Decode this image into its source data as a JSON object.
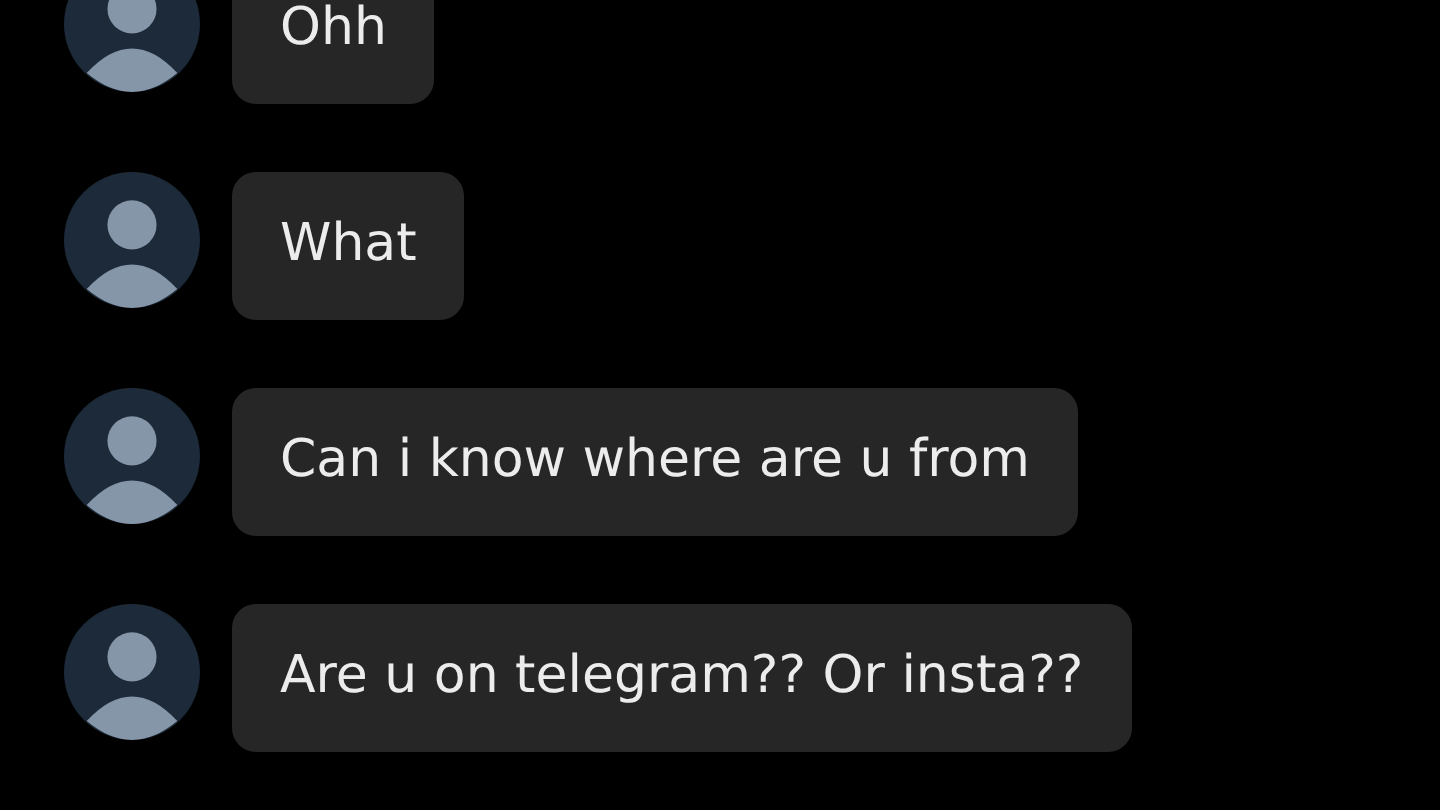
{
  "messages": [
    {
      "text": "Ohh"
    },
    {
      "text": "What"
    },
    {
      "text": "Can i know where are u from"
    },
    {
      "text": "Are u on telegram?? Or insta??"
    }
  ]
}
